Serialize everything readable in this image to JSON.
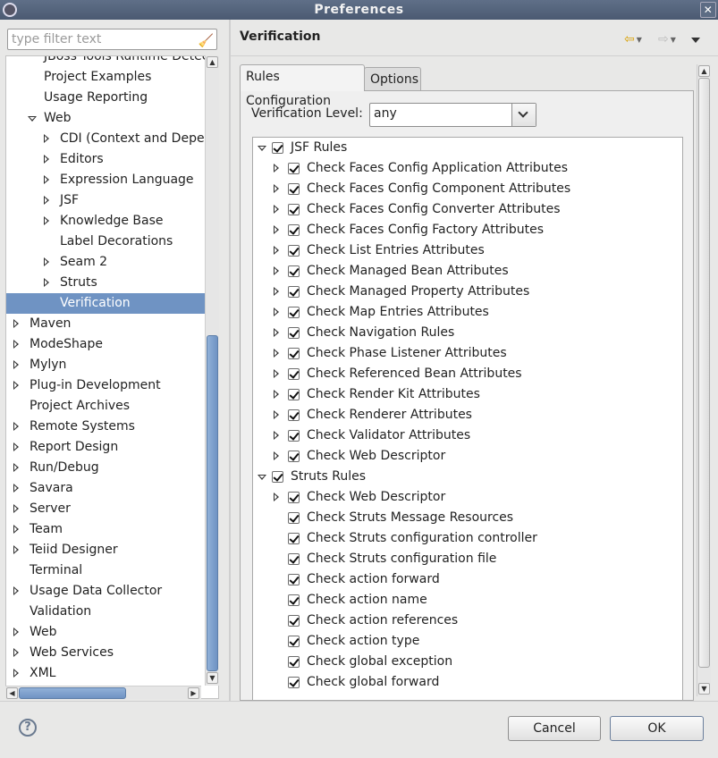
{
  "window": {
    "title": "Preferences"
  },
  "filter": {
    "placeholder": "type filter text"
  },
  "tree": [
    {
      "label": "JBoss Tools Runtime Detecti",
      "indent": 1,
      "expander": "none"
    },
    {
      "label": "Project Examples",
      "indent": 1,
      "expander": "none"
    },
    {
      "label": "Usage Reporting",
      "indent": 1,
      "expander": "none"
    },
    {
      "label": "Web",
      "indent": 1,
      "expander": "open"
    },
    {
      "label": "CDI (Context and Depend",
      "indent": 2,
      "expander": "closed"
    },
    {
      "label": "Editors",
      "indent": 2,
      "expander": "closed"
    },
    {
      "label": "Expression Language",
      "indent": 2,
      "expander": "closed"
    },
    {
      "label": "JSF",
      "indent": 2,
      "expander": "closed"
    },
    {
      "label": "Knowledge Base",
      "indent": 2,
      "expander": "closed"
    },
    {
      "label": "Label Decorations",
      "indent": 2,
      "expander": "none"
    },
    {
      "label": "Seam 2",
      "indent": 2,
      "expander": "closed"
    },
    {
      "label": "Struts",
      "indent": 2,
      "expander": "closed"
    },
    {
      "label": "Verification",
      "indent": 2,
      "expander": "none",
      "selected": true
    },
    {
      "label": "Maven",
      "indent": 0,
      "expander": "closed"
    },
    {
      "label": "ModeShape",
      "indent": 0,
      "expander": "closed"
    },
    {
      "label": "Mylyn",
      "indent": 0,
      "expander": "closed"
    },
    {
      "label": "Plug-in Development",
      "indent": 0,
      "expander": "closed"
    },
    {
      "label": "Project Archives",
      "indent": 0,
      "expander": "none"
    },
    {
      "label": "Remote Systems",
      "indent": 0,
      "expander": "closed"
    },
    {
      "label": "Report Design",
      "indent": 0,
      "expander": "closed"
    },
    {
      "label": "Run/Debug",
      "indent": 0,
      "expander": "closed"
    },
    {
      "label": "Savara",
      "indent": 0,
      "expander": "closed"
    },
    {
      "label": "Server",
      "indent": 0,
      "expander": "closed"
    },
    {
      "label": "Team",
      "indent": 0,
      "expander": "closed"
    },
    {
      "label": "Teiid Designer",
      "indent": 0,
      "expander": "closed"
    },
    {
      "label": "Terminal",
      "indent": 0,
      "expander": "none"
    },
    {
      "label": "Usage Data Collector",
      "indent": 0,
      "expander": "closed"
    },
    {
      "label": "Validation",
      "indent": 0,
      "expander": "none"
    },
    {
      "label": "Web",
      "indent": 0,
      "expander": "closed"
    },
    {
      "label": "Web Services",
      "indent": 0,
      "expander": "closed"
    },
    {
      "label": "XML",
      "indent": 0,
      "expander": "closed"
    }
  ],
  "page": {
    "title": "Verification",
    "tabs": [
      "Rules Configuration",
      "Options"
    ],
    "active_tab": 0,
    "level_label": "Verification Level:",
    "level_value": "any"
  },
  "rules": [
    {
      "label": "JSF Rules",
      "level": 0,
      "expander": "open",
      "checked": true
    },
    {
      "label": "Check Faces Config Application Attributes",
      "level": 1,
      "expander": "closed",
      "checked": true
    },
    {
      "label": "Check Faces Config Component Attributes",
      "level": 1,
      "expander": "closed",
      "checked": true
    },
    {
      "label": "Check Faces Config Converter Attributes",
      "level": 1,
      "expander": "closed",
      "checked": true
    },
    {
      "label": "Check Faces Config Factory Attributes",
      "level": 1,
      "expander": "closed",
      "checked": true
    },
    {
      "label": "Check List Entries Attributes",
      "level": 1,
      "expander": "closed",
      "checked": true
    },
    {
      "label": "Check Managed Bean Attributes",
      "level": 1,
      "expander": "closed",
      "checked": true
    },
    {
      "label": "Check Managed Property Attributes",
      "level": 1,
      "expander": "closed",
      "checked": true
    },
    {
      "label": "Check Map Entries Attributes",
      "level": 1,
      "expander": "closed",
      "checked": true
    },
    {
      "label": "Check Navigation Rules",
      "level": 1,
      "expander": "closed",
      "checked": true
    },
    {
      "label": "Check Phase Listener Attributes",
      "level": 1,
      "expander": "closed",
      "checked": true
    },
    {
      "label": "Check Referenced Bean Attributes",
      "level": 1,
      "expander": "closed",
      "checked": true
    },
    {
      "label": "Check Render Kit Attributes",
      "level": 1,
      "expander": "closed",
      "checked": true
    },
    {
      "label": "Check Renderer Attributes",
      "level": 1,
      "expander": "closed",
      "checked": true
    },
    {
      "label": "Check Validator Attributes",
      "level": 1,
      "expander": "closed",
      "checked": true
    },
    {
      "label": "Check Web Descriptor",
      "level": 1,
      "expander": "closed",
      "checked": true
    },
    {
      "label": "Struts Rules",
      "level": 0,
      "expander": "open",
      "checked": true
    },
    {
      "label": "Check Web Descriptor",
      "level": 1,
      "expander": "closed",
      "checked": true
    },
    {
      "label": "Check Struts Message Resources",
      "level": 1,
      "expander": "none",
      "checked": true
    },
    {
      "label": "Check Struts configuration controller",
      "level": 1,
      "expander": "none",
      "checked": true
    },
    {
      "label": "Check Struts configuration file",
      "level": 1,
      "expander": "none",
      "checked": true
    },
    {
      "label": "Check action forward",
      "level": 1,
      "expander": "none",
      "checked": true
    },
    {
      "label": "Check action name",
      "level": 1,
      "expander": "none",
      "checked": true
    },
    {
      "label": "Check action references",
      "level": 1,
      "expander": "none",
      "checked": true
    },
    {
      "label": "Check action type",
      "level": 1,
      "expander": "none",
      "checked": true
    },
    {
      "label": "Check global exception",
      "level": 1,
      "expander": "none",
      "checked": true
    },
    {
      "label": "Check global forward",
      "level": 1,
      "expander": "none",
      "checked": true
    }
  ],
  "buttons": {
    "cancel": "Cancel",
    "ok": "OK"
  },
  "icons": {
    "window": "eclipse-logo-icon",
    "close": "close-icon",
    "filter_clear": "broom-icon",
    "back": "back-arrow-icon",
    "forward": "forward-arrow-icon",
    "menu": "view-menu-icon",
    "help": "help-icon"
  },
  "colors": {
    "selection": "#6f93c3",
    "titlebar": "#55647c"
  }
}
